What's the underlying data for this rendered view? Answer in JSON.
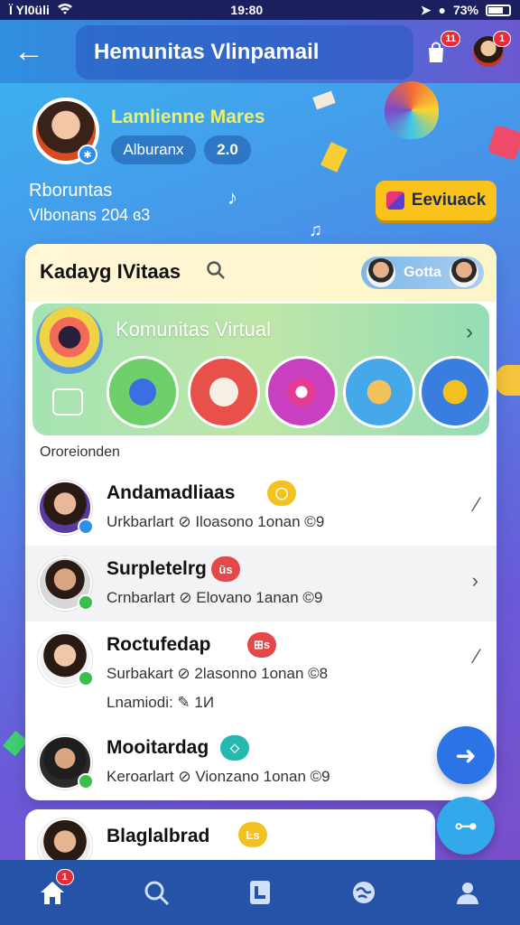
{
  "status_bar": {
    "carrier": "Ï Yl0üli",
    "time": "19:80",
    "battery": "73%"
  },
  "header": {
    "title": "Hemunitas Vlinpamail",
    "notif_count": "11",
    "avatar_badge": "1"
  },
  "profile": {
    "name": "Lamlienne Mares",
    "tag": "Alburanx",
    "count": "2.0",
    "community_label": "Rboruntas",
    "community_sub": "Vlbonans 204  ɞ3"
  },
  "cta": {
    "label": "Eeviuack"
  },
  "panel": {
    "title": "Kadayg IVitaas",
    "friends_chip": "Gotta",
    "banner_title": "Komunitas Virtual",
    "banner_arrow": "›",
    "section_label": "Ororeionden"
  },
  "list": [
    {
      "name": "Andamadliaas",
      "badge": "◯",
      "badge_color": "#f3c220",
      "status_color": "#2c8fea",
      "meta": "Urkbarlart  ⊘  Iloasono 1onan ©9",
      "chevron": "⁄"
    },
    {
      "name": "Surpletelrg",
      "badge": "ūs",
      "badge_color": "#e54848",
      "status_color": "#3bbf4c",
      "meta": "Crnbarlart  ⊘  Elovano 1anan ©9",
      "chevron": "›"
    },
    {
      "name": "Roctufedap",
      "badge": "⊞s",
      "badge_color": "#e54848",
      "status_color": "#3bbf4c",
      "meta": "Surbakart  ⊘  2lasonno 1onan ©8",
      "extra": "Lnamiodi:  ✎  1И",
      "chevron": "⁄"
    },
    {
      "name": "Mooitardag",
      "badge": "◇",
      "badge_color": "#23b8b0",
      "status_color": "#3bbf4c",
      "meta": "Keroarlart  ⊘  Vionzano 1onan ©9",
      "chevron": ""
    }
  ],
  "peek": {
    "name": "Blaglalbrad",
    "badge": "Ŀs"
  },
  "fab": {
    "primary": "➜",
    "secondary": "⊶"
  },
  "tabs": [
    {
      "icon": "home-icon",
      "badge": "1"
    },
    {
      "icon": "search-icon"
    },
    {
      "icon": "document-icon"
    },
    {
      "icon": "globe-icon"
    },
    {
      "icon": "profile-icon"
    }
  ]
}
